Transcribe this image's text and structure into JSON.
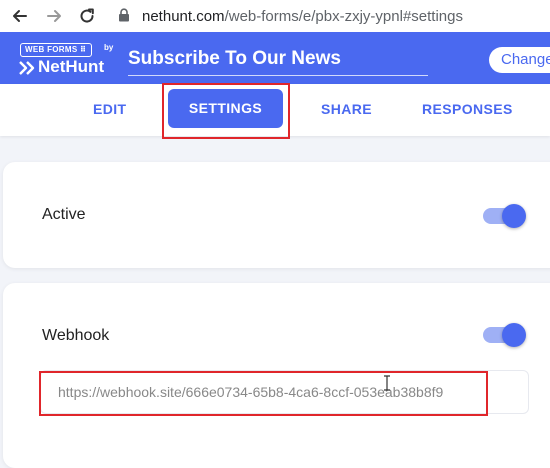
{
  "browser": {
    "url_host": "nethunt.com",
    "url_path": "/web-forms/e/pbx-zxjy-ypnl#settings",
    "icons": [
      "back-arrow-icon",
      "forward-arrow-icon",
      "reload-icon",
      "lock-icon"
    ]
  },
  "header": {
    "logo_badge": "WEB FORMS ⠿",
    "logo_by": "by",
    "logo_name": "NetHunt",
    "form_title": "Subscribe To Our News",
    "changes_label": "Changes"
  },
  "tabs": [
    {
      "label": "EDIT"
    },
    {
      "label": "SETTINGS",
      "active": true
    },
    {
      "label": "SHARE"
    },
    {
      "label": "RESPONSES"
    }
  ],
  "settings": {
    "active": {
      "label": "Active",
      "enabled": true
    },
    "webhook": {
      "label": "Webhook",
      "enabled": true,
      "url_value": "https://webhook.site/666e0734-65b8-4ca6-8ccf-053eab38b8f9"
    }
  },
  "colors": {
    "accent": "#4a69f0",
    "highlight": "#e0262b",
    "background": "#f2f4f9"
  }
}
